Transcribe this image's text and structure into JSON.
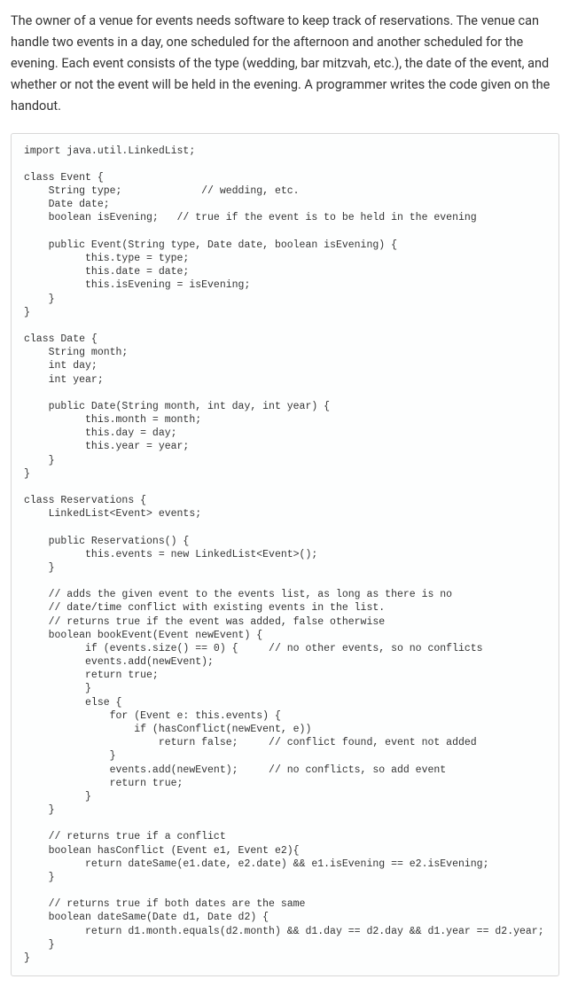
{
  "description": "The owner of a venue for events needs software to keep track of reservations. The venue can handle two events in a day, one scheduled for the afternoon and another scheduled for the evening. Each event consists of the type (wedding, bar mitzvah, etc.), the date of the event, and whether or not the event will be held in the evening. A programmer writes the code given on the handout.",
  "code": "import java.util.LinkedList;\n\nclass Event {\n    String type;             // wedding, etc.\n    Date date;\n    boolean isEvening;   // true if the event is to be held in the evening\n\n    public Event(String type, Date date, boolean isEvening) {\n          this.type = type;\n          this.date = date;\n          this.isEvening = isEvening;\n    }\n}\n\nclass Date {\n    String month;\n    int day;\n    int year;\n\n    public Date(String month, int day, int year) {\n          this.month = month;\n          this.day = day;\n          this.year = year;\n    }\n}\n\nclass Reservations {\n    LinkedList<Event> events;\n\n    public Reservations() {\n          this.events = new LinkedList<Event>();\n    }\n\n    // adds the given event to the events list, as long as there is no\n    // date/time conflict with existing events in the list.\n    // returns true if the event was added, false otherwise\n    boolean bookEvent(Event newEvent) {\n          if (events.size() == 0) {     // no other events, so no conflicts\n          events.add(newEvent);\n          return true;\n          }\n          else {\n              for (Event e: this.events) {\n                  if (hasConflict(newEvent, e))\n                      return false;     // conflict found, event not added\n              }\n              events.add(newEvent);     // no conflicts, so add event\n              return true;\n          }\n    }\n\n    // returns true if a conflict\n    boolean hasConflict (Event e1, Event e2){\n          return dateSame(e1.date, e2.date) && e1.isEvening == e2.isEvening;\n    }\n\n    // returns true if both dates are the same\n    boolean dateSame(Date d1, Date d2) {\n          return d1.month.equals(d2.month) && d1.day == d2.day && d1.year == d2.year;\n    }\n}"
}
